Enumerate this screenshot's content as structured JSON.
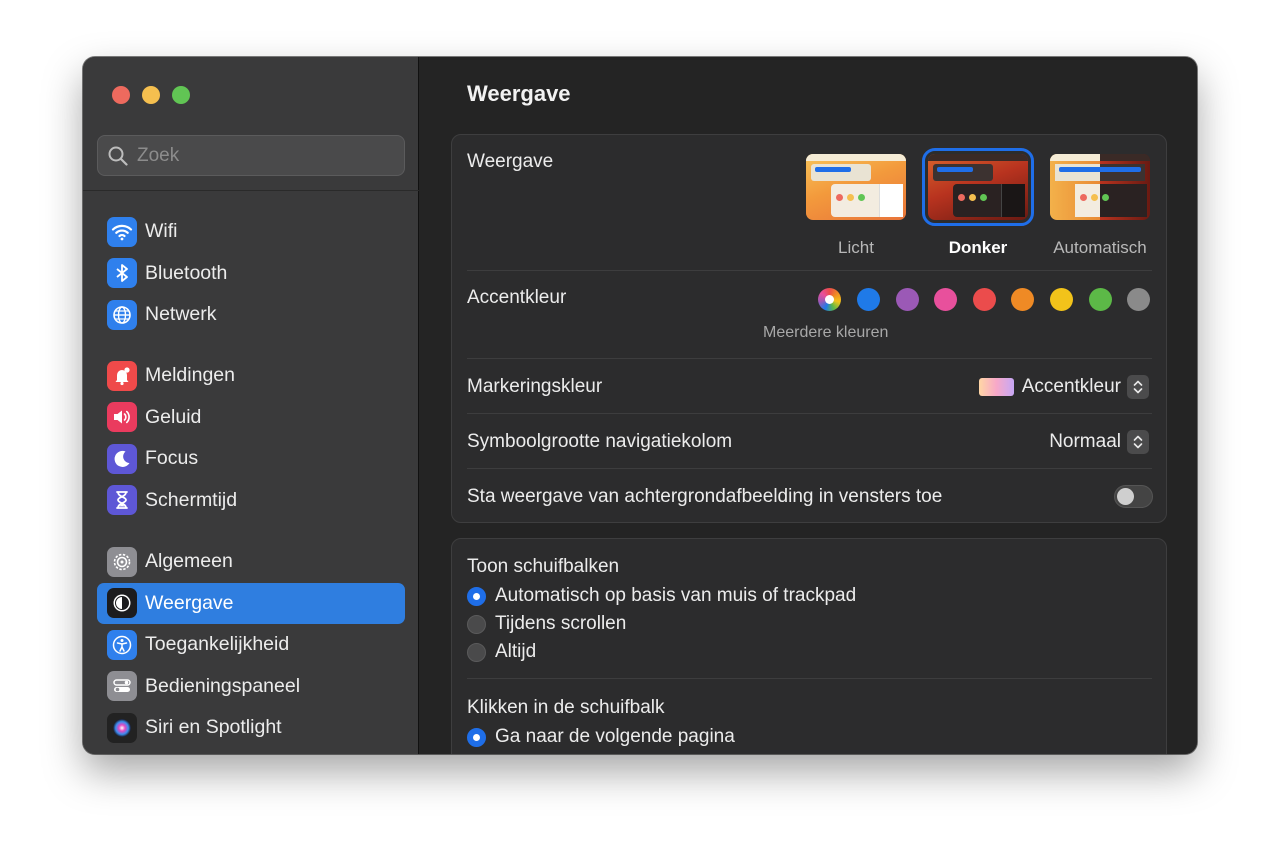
{
  "window": {
    "traffic_lights": [
      "close",
      "minimize",
      "maximize"
    ]
  },
  "search": {
    "placeholder": "Zoek"
  },
  "sidebar": {
    "groups": [
      {
        "items": [
          {
            "label": "Wifi",
            "icon": "wifi-icon",
            "color": "#2f80ed"
          },
          {
            "label": "Bluetooth",
            "icon": "bluetooth-icon",
            "color": "#2f80ed"
          },
          {
            "label": "Netwerk",
            "icon": "globe-icon",
            "color": "#2f80ed"
          }
        ]
      },
      {
        "items": [
          {
            "label": "Meldingen",
            "icon": "bell-icon",
            "color": "#ef4a4a"
          },
          {
            "label": "Geluid",
            "icon": "speaker-icon",
            "color": "#ea3b5e"
          },
          {
            "label": "Focus",
            "icon": "moon-icon",
            "color": "#5e57d6"
          },
          {
            "label": "Schermtijd",
            "icon": "hourglass-icon",
            "color": "#5e57d6"
          }
        ]
      },
      {
        "items": [
          {
            "label": "Algemeen",
            "icon": "gear-icon",
            "color": "#8e8e93"
          },
          {
            "label": "Weergave",
            "icon": "appearance-icon",
            "color": "#1c1c1e",
            "active": true
          },
          {
            "label": "Toegankelijkheid",
            "icon": "accessibility-icon",
            "color": "#2f80ed"
          },
          {
            "label": "Bedieningspaneel",
            "icon": "control-center-icon",
            "color": "#8e8e93"
          },
          {
            "label": "Siri en Spotlight",
            "icon": "siri-icon",
            "color": "#222"
          }
        ]
      }
    ]
  },
  "main": {
    "title": "Weergave",
    "appearance": {
      "label": "Weergave",
      "options": [
        {
          "label": "Licht",
          "selected": false
        },
        {
          "label": "Donker",
          "selected": true
        },
        {
          "label": "Automatisch",
          "selected": false
        }
      ]
    },
    "accent": {
      "label": "Accentkleur",
      "multi_label": "Meerdere kleuren",
      "colors": [
        "multicolor",
        "#1f7ae8",
        "#9b59b6",
        "#e8509c",
        "#eb4c4c",
        "#ef8a25",
        "#f2c31a",
        "#5cb947",
        "#8a8a8a"
      ]
    },
    "highlight": {
      "label": "Markeringskleur",
      "value": "Accentkleur"
    },
    "sidebar_icon_size": {
      "label": "Symboolgrootte navigatiekolom",
      "value": "Normaal"
    },
    "wallpaper_tinting": {
      "label": "Sta weergave van achtergrondafbeelding in vensters toe",
      "enabled": false
    },
    "scrollbars": {
      "label": "Toon schuifbalken",
      "options": [
        {
          "label": "Automatisch op basis van muis of trackpad",
          "selected": true
        },
        {
          "label": "Tijdens scrollen",
          "selected": false
        },
        {
          "label": "Altijd",
          "selected": false
        }
      ]
    },
    "click_scrollbar": {
      "label": "Klikken in de schuifbalk",
      "options": [
        {
          "label": "Ga naar de volgende pagina",
          "selected": true
        }
      ]
    }
  }
}
